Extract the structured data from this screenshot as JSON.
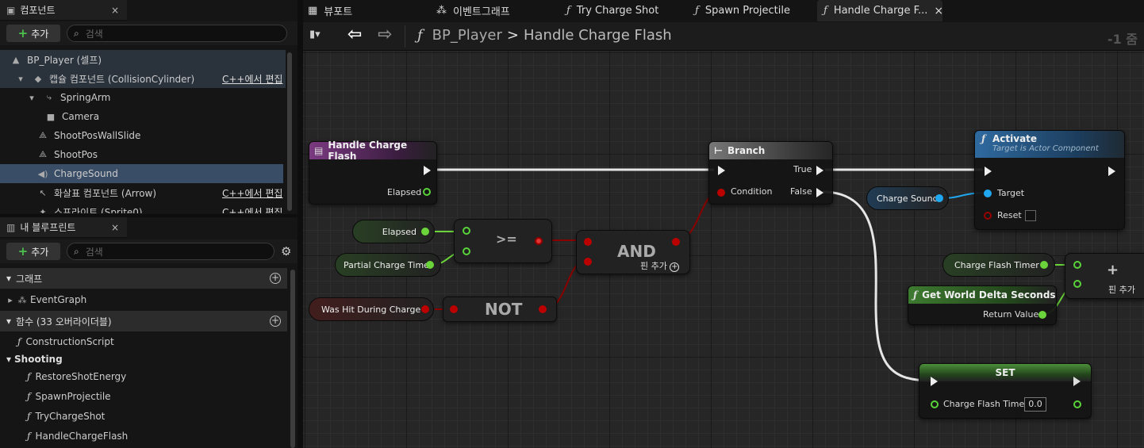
{
  "components_panel": {
    "title": "컴포넌트",
    "close": "×",
    "add_label": "추가",
    "search_placeholder": "검색",
    "items": [
      {
        "label": "BP_Player (셀프)"
      },
      {
        "label": "캡슐 컴포넌트 (CollisionCylinder)",
        "edit": "C++에서 편집"
      },
      {
        "label": "SpringArm"
      },
      {
        "label": "Camera"
      },
      {
        "label": "ShootPosWallSlide"
      },
      {
        "label": "ShootPos"
      },
      {
        "label": "ChargeSound"
      },
      {
        "label": "화살표 컴포넌트 (Arrow)",
        "edit": "C++에서 편집"
      },
      {
        "label": "스프라이트 (Sprite0)",
        "edit": "C++에서 편집"
      }
    ]
  },
  "blueprint_panel": {
    "title": "내 블루프린트",
    "close": "×",
    "add_label": "추가",
    "search_placeholder": "검색",
    "graph_section": "그래프",
    "event_graph": "EventGraph",
    "functions_section": "함수 (33 오버라이더블)",
    "construction": "ConstructionScript",
    "category": "Shooting",
    "functions": [
      "RestoreShotEnergy",
      "SpawnProjectile",
      "TryChargeShot",
      "HandleChargeFlash"
    ]
  },
  "tabs": [
    {
      "label": "뷰포트"
    },
    {
      "label": "이벤트그래프"
    },
    {
      "label": "Try Charge Shot"
    },
    {
      "label": "Spawn Projectile"
    },
    {
      "label": "Handle Charge F...",
      "close": "×"
    }
  ],
  "toolbar": {
    "breadcrumb_root": "BP_Player",
    "breadcrumb_sep": ">",
    "breadcrumb_current": "Handle Charge Flash",
    "zoom": "-1 줌"
  },
  "graph": {
    "entry": {
      "title": "Handle Charge Flash",
      "elapsed": "Elapsed"
    },
    "branch": {
      "title": "Branch",
      "condition": "Condition",
      "true": "True",
      "false": "False"
    },
    "activate": {
      "title": "Activate",
      "subtitle": "Target is Actor Component",
      "target": "Target",
      "reset": "Reset"
    },
    "elapsed_var": "Elapsed",
    "partial_var": "Partial Charge Time",
    "ge_op": ">=",
    "and_op": "AND",
    "add_pin": "핀 추가",
    "hit_var": "Was Hit During Charge",
    "not_op": "NOT",
    "sound_var": "Charge Sound",
    "timer_var": "Charge Flash Timer",
    "delta": {
      "title": "Get World Delta Seconds",
      "ret": "Return Value"
    },
    "add_pin2": "핀 추가",
    "plus": "+",
    "set": {
      "title": "SET",
      "pin": "Charge Flash Timer",
      "value": "0.0"
    }
  },
  "colors": {
    "accent_select": "#3a4d66",
    "exec": "#eeeeee",
    "bool": "#b00000",
    "float": "#6ad43a",
    "object": "#1fa8f0"
  }
}
